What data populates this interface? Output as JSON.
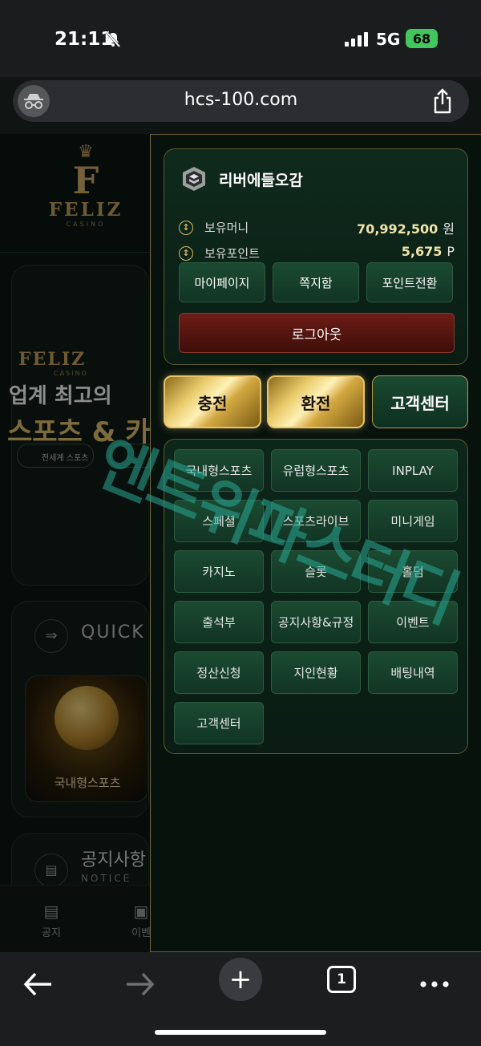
{
  "status_bar": {
    "time": "21:11",
    "network": "5G",
    "battery": "68"
  },
  "browser": {
    "url": "hcs-100.com",
    "tab_count": "1"
  },
  "background_page": {
    "logo_word": "FELIZ",
    "logo_sub": "CASINO",
    "banner_logo": "FELIZ",
    "banner_casino": "CASINO",
    "banner_line1": "업계 최고의",
    "banner_line2": "스포츠 & 카",
    "banner_chip": "전세계 스포츠",
    "quick_menu_title": "QUICK M",
    "quick_card_label": "국내형스포츠",
    "notice_title": "공지사항",
    "notice_sub": "NOTICE",
    "bottom_nav": [
      "공지",
      "이벤"
    ]
  },
  "user": {
    "name": "리버에들오감",
    "money_label": "보유머니",
    "money_value": "70,992,500",
    "money_unit": "원",
    "points_label": "보유포인트",
    "points_value": "5,675",
    "points_unit": "P"
  },
  "account_buttons": [
    "마이페이지",
    "쪽지함",
    "포인트전환"
  ],
  "logout_label": "로그아웃",
  "main_buttons": {
    "deposit": "충전",
    "withdraw": "환전",
    "support": "고객센터"
  },
  "menu_items": [
    "국내형스포츠",
    "유럽형스포츠",
    "INPLAY",
    "스페셜",
    "스포츠라이브",
    "미니게임",
    "카지노",
    "슬롯",
    "홀덤",
    "출석부",
    "공지사항&규정",
    "이벤트",
    "정산신청",
    "지인현황",
    "배팅내역",
    "고객센터"
  ],
  "watermark": "엔트위파스터디"
}
